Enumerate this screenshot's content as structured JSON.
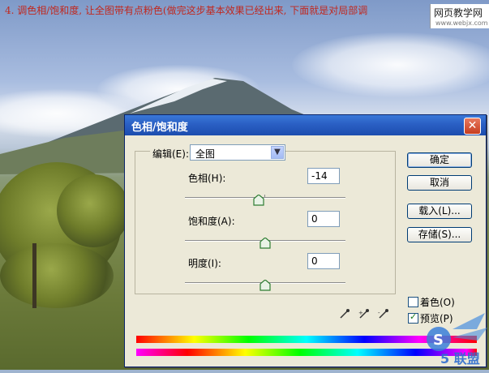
{
  "caption": "4. 调色相/饱和度, 让全图带有点粉色(做完这步基本效果已经出来, 下面就是对局部调",
  "site_badge": {
    "name": "网页教学网",
    "url": "www.webjx.com"
  },
  "dialog": {
    "title": "色相/饱和度",
    "edit_label": "编辑(E):",
    "edit_value": "全图",
    "sliders": [
      {
        "label": "色相(H):",
        "value": "-14",
        "level": 0.46
      },
      {
        "label": "饱和度(A):",
        "value": "0",
        "level": 0.5
      },
      {
        "label": "明度(I):",
        "value": "0",
        "level": 0.5
      }
    ],
    "buttons": {
      "ok": "确定",
      "cancel": "取消",
      "load": "载入(L)...",
      "save": "存储(S)..."
    },
    "colorize_label": "着色(O)",
    "preview_label": "预览(P)",
    "colorize_checked": false,
    "preview_checked": true
  },
  "colors": {
    "titlebar": "#2a5fc4",
    "caption": "#c0281f"
  },
  "icons": [
    "close-icon",
    "chevron-down-icon",
    "eyedropper-icon",
    "eyedropper-plus-icon",
    "eyedropper-minus-icon",
    "check-icon"
  ],
  "watermark_text": "5 联盟"
}
